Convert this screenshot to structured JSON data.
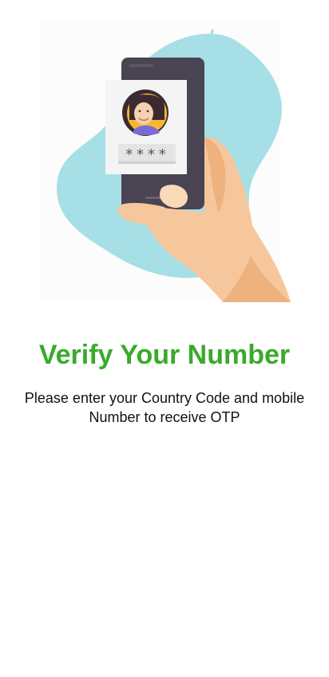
{
  "colors": {
    "title": "#3aaa2a",
    "blob": "#a6dfe6",
    "phone_body": "#4a4352",
    "card": "#f4f4f4",
    "skin": "#f6c79c",
    "skin_shadow": "#eeb27f",
    "hair": "#3b2a2f",
    "avatar_bg": "#f5b731",
    "shirt": "#7a6ad8"
  },
  "illustration": {
    "icon": "phone-verification-illustration",
    "pin_mask": "****"
  },
  "header": {
    "title": "Verify Your Number",
    "subtitle_line1": "Please enter your Country Code and mobile",
    "subtitle_line2": "Number to receive OTP"
  }
}
